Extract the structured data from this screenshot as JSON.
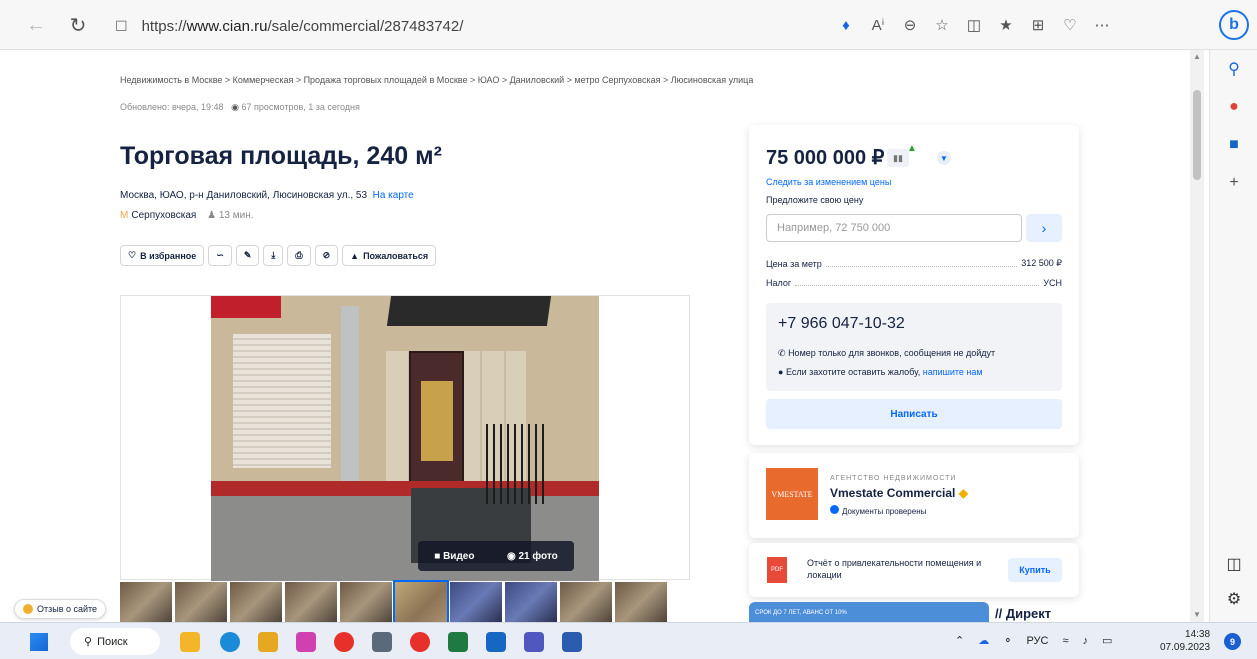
{
  "browser": {
    "url_prefix": "https://",
    "url_host": "www.cian.ru",
    "url_path": "/sale/commercial/287483742/",
    "bing_label": "b"
  },
  "breadcrumb": "Недвижимость в Москве  >  Коммерческая  >  Продажа торговых площадей в Москве  >  ЮАО  >  Даниловский  >  метро Серпуховская  >  Люсиновская улица",
  "updated": "Обновлено: вчера, 19:48",
  "views": "67 просмотров, 1 за сегодня",
  "listing": {
    "title": "Торговая площадь, 240 м²",
    "address": "Москва, ЮАО, р-н Даниловский, Люсиновская ул., 53",
    "map_link": "На карте",
    "metro_station": "Серпуховская",
    "metro_walk": "13 мин."
  },
  "actions": {
    "favorite": "В избранное",
    "complain": "Пожаловаться"
  },
  "gallery": {
    "video_label": "Видео",
    "photos_label": "21 фото",
    "thumb_count": 10,
    "active_thumb": 5
  },
  "feedback_label": "Отзыв о сайте",
  "price_card": {
    "price": "75 000 000 ₽",
    "follow_label": "Следить за изменением цены",
    "offer_label": "Предложите свою цену",
    "offer_placeholder": "Например, 72 750 000",
    "per_meter_label": "Цена за метр",
    "per_meter_value": "312 500 ₽",
    "tax_label": "Налог",
    "tax_value": "УСН",
    "phone": "+7 966 047-10-32",
    "phone_note": "Номер только для звонков, сообщения не дойдут",
    "complaint_note": "Если захотите оставить жалобу,",
    "complaint_link": "напишите нам",
    "write_button": "Написать"
  },
  "agency": {
    "kind": "АГЕНТСТВО НЕДВИЖИМОСТИ",
    "name": "Vmestate Commercial",
    "verified": "Документы проверены",
    "logo_text": "VMESTATE"
  },
  "report": {
    "text": "Отчёт о привлекательности помещения и локации",
    "buy_button": "Купить",
    "pdf_label": "PDF"
  },
  "ad": {
    "strip_text": "СРОК ДО 7 ЛЕТ, АВАНС ОТ 10%",
    "direct": "Директ"
  },
  "taskbar": {
    "search_label": "Поиск",
    "lang": "РУС",
    "time": "14:38",
    "date": "07.09.2023",
    "notif_count": "9"
  }
}
